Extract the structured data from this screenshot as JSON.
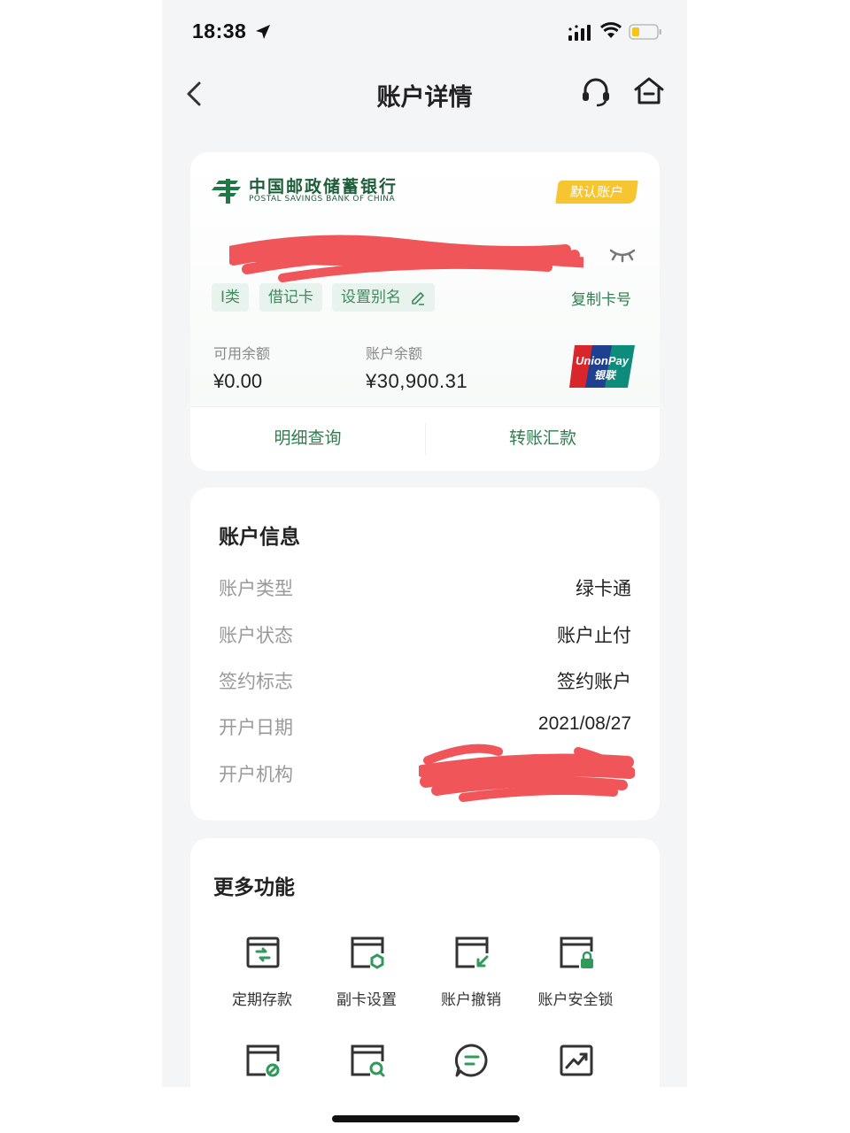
{
  "status_bar": {
    "time": "18:38",
    "icons": [
      "location-arrow-icon",
      "signal-icon",
      "wifi-icon",
      "battery-icon"
    ]
  },
  "nav": {
    "title": "账户详情",
    "back_icon": "chevron-left-icon",
    "service_icon": "headset-icon",
    "home_icon": "home-icon"
  },
  "card": {
    "bank_name_cn": "中国邮政储蓄银行",
    "bank_name_en": "POSTAL SAVINGS BANK OF CHINA",
    "default_badge": "默认账户",
    "tags": [
      "I类",
      "借记卡",
      "设置别名"
    ],
    "copy_link": "复制卡号",
    "available_label": "可用余额",
    "available_value": "¥0.00",
    "balance_label": "账户余额",
    "balance_value": "¥30,900.31",
    "unionpay_text": "UnionPay",
    "unionpay_cn": "银联",
    "actions": [
      "明细查询",
      "转账汇款"
    ]
  },
  "account_info": {
    "title": "账户信息",
    "rows": [
      {
        "label": "账户类型",
        "value": "绿卡通"
      },
      {
        "label": "账户状态",
        "value": "账户止付"
      },
      {
        "label": "签约标志",
        "value": "签约账户"
      },
      {
        "label": "开户日期",
        "value": "2021/08/27"
      },
      {
        "label": "开户机构",
        "value": ""
      }
    ]
  },
  "more_functions": {
    "title": "更多功能",
    "items": [
      {
        "label": "定期存款",
        "icon": "fixed-deposit-icon"
      },
      {
        "label": "副卡设置",
        "icon": "sub-card-settings-icon"
      },
      {
        "label": "账户撤销",
        "icon": "account-cancel-icon"
      },
      {
        "label": "账户安全锁",
        "icon": "account-lock-icon"
      },
      {
        "label": "",
        "icon": "card-link-icon"
      },
      {
        "label": "",
        "icon": "card-search-icon"
      },
      {
        "label": "",
        "icon": "chat-icon"
      },
      {
        "label": "",
        "icon": "chart-trend-icon"
      }
    ]
  },
  "colors": {
    "brand_green": "#2f7d4f",
    "bank_green": "#1d5d3a",
    "badge_yellow": "#f7c531",
    "redact_red": "#f0555a"
  }
}
